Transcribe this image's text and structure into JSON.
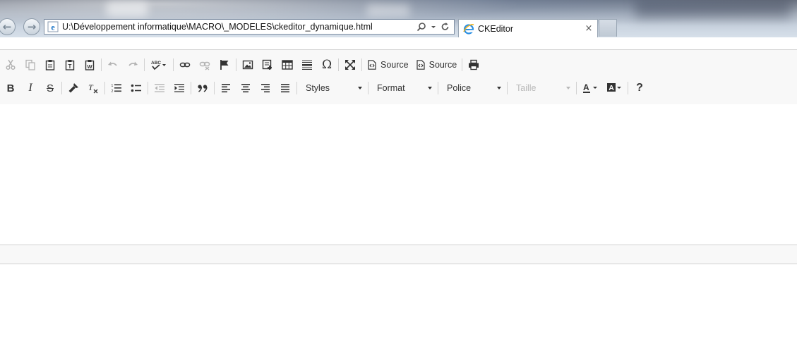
{
  "browser": {
    "address": "U:\\Développement informatique\\MACRO\\_MODELES\\ckeditor_dynamique.html",
    "tab_title": "CKEditor",
    "nav_back": "←",
    "nav_forward": "→",
    "tab_close": "×",
    "search_icon": "search-icon",
    "refresh_icon": "refresh-icon"
  },
  "toolbar": {
    "row1": [
      {
        "name": "cut-icon",
        "enabled": false
      },
      {
        "name": "copy-icon",
        "enabled": false
      },
      {
        "name": "paste-icon",
        "enabled": true
      },
      {
        "name": "paste-text-icon",
        "enabled": true
      },
      {
        "name": "paste-word-icon",
        "enabled": true
      },
      {
        "name": "undo-icon",
        "enabled": false
      },
      {
        "name": "redo-icon",
        "enabled": false
      },
      {
        "name": "spellcheck-icon",
        "enabled": true
      },
      {
        "name": "link-icon",
        "enabled": true
      },
      {
        "name": "unlink-icon",
        "enabled": false
      },
      {
        "name": "anchor-icon",
        "enabled": true
      },
      {
        "name": "image-icon",
        "enabled": true
      },
      {
        "name": "flash-icon",
        "enabled": true
      },
      {
        "name": "table-icon",
        "enabled": true
      },
      {
        "name": "horizontal-rule-icon",
        "enabled": true
      },
      {
        "name": "special-char-icon",
        "enabled": true
      },
      {
        "name": "maximize-icon",
        "enabled": true
      },
      {
        "name": "print-icon",
        "enabled": true
      }
    ],
    "source_label_1": "Source",
    "source_label_2": "Source",
    "special_char_glyph": "Ω",
    "help_glyph": "?",
    "format_glyphs": {
      "bold": "B",
      "italic": "I",
      "strike": "S",
      "remove": "T"
    },
    "combos": {
      "styles": "Styles",
      "format": "Format",
      "font": "Police",
      "size": "Taille"
    },
    "text_color_glyph": "A",
    "bg_color_glyph": "A"
  },
  "colors": {
    "toolbar_bg": "#f8f8f8",
    "border": "#d1d1d1",
    "icon": "#333333",
    "disabled": "#b3b3b3"
  }
}
